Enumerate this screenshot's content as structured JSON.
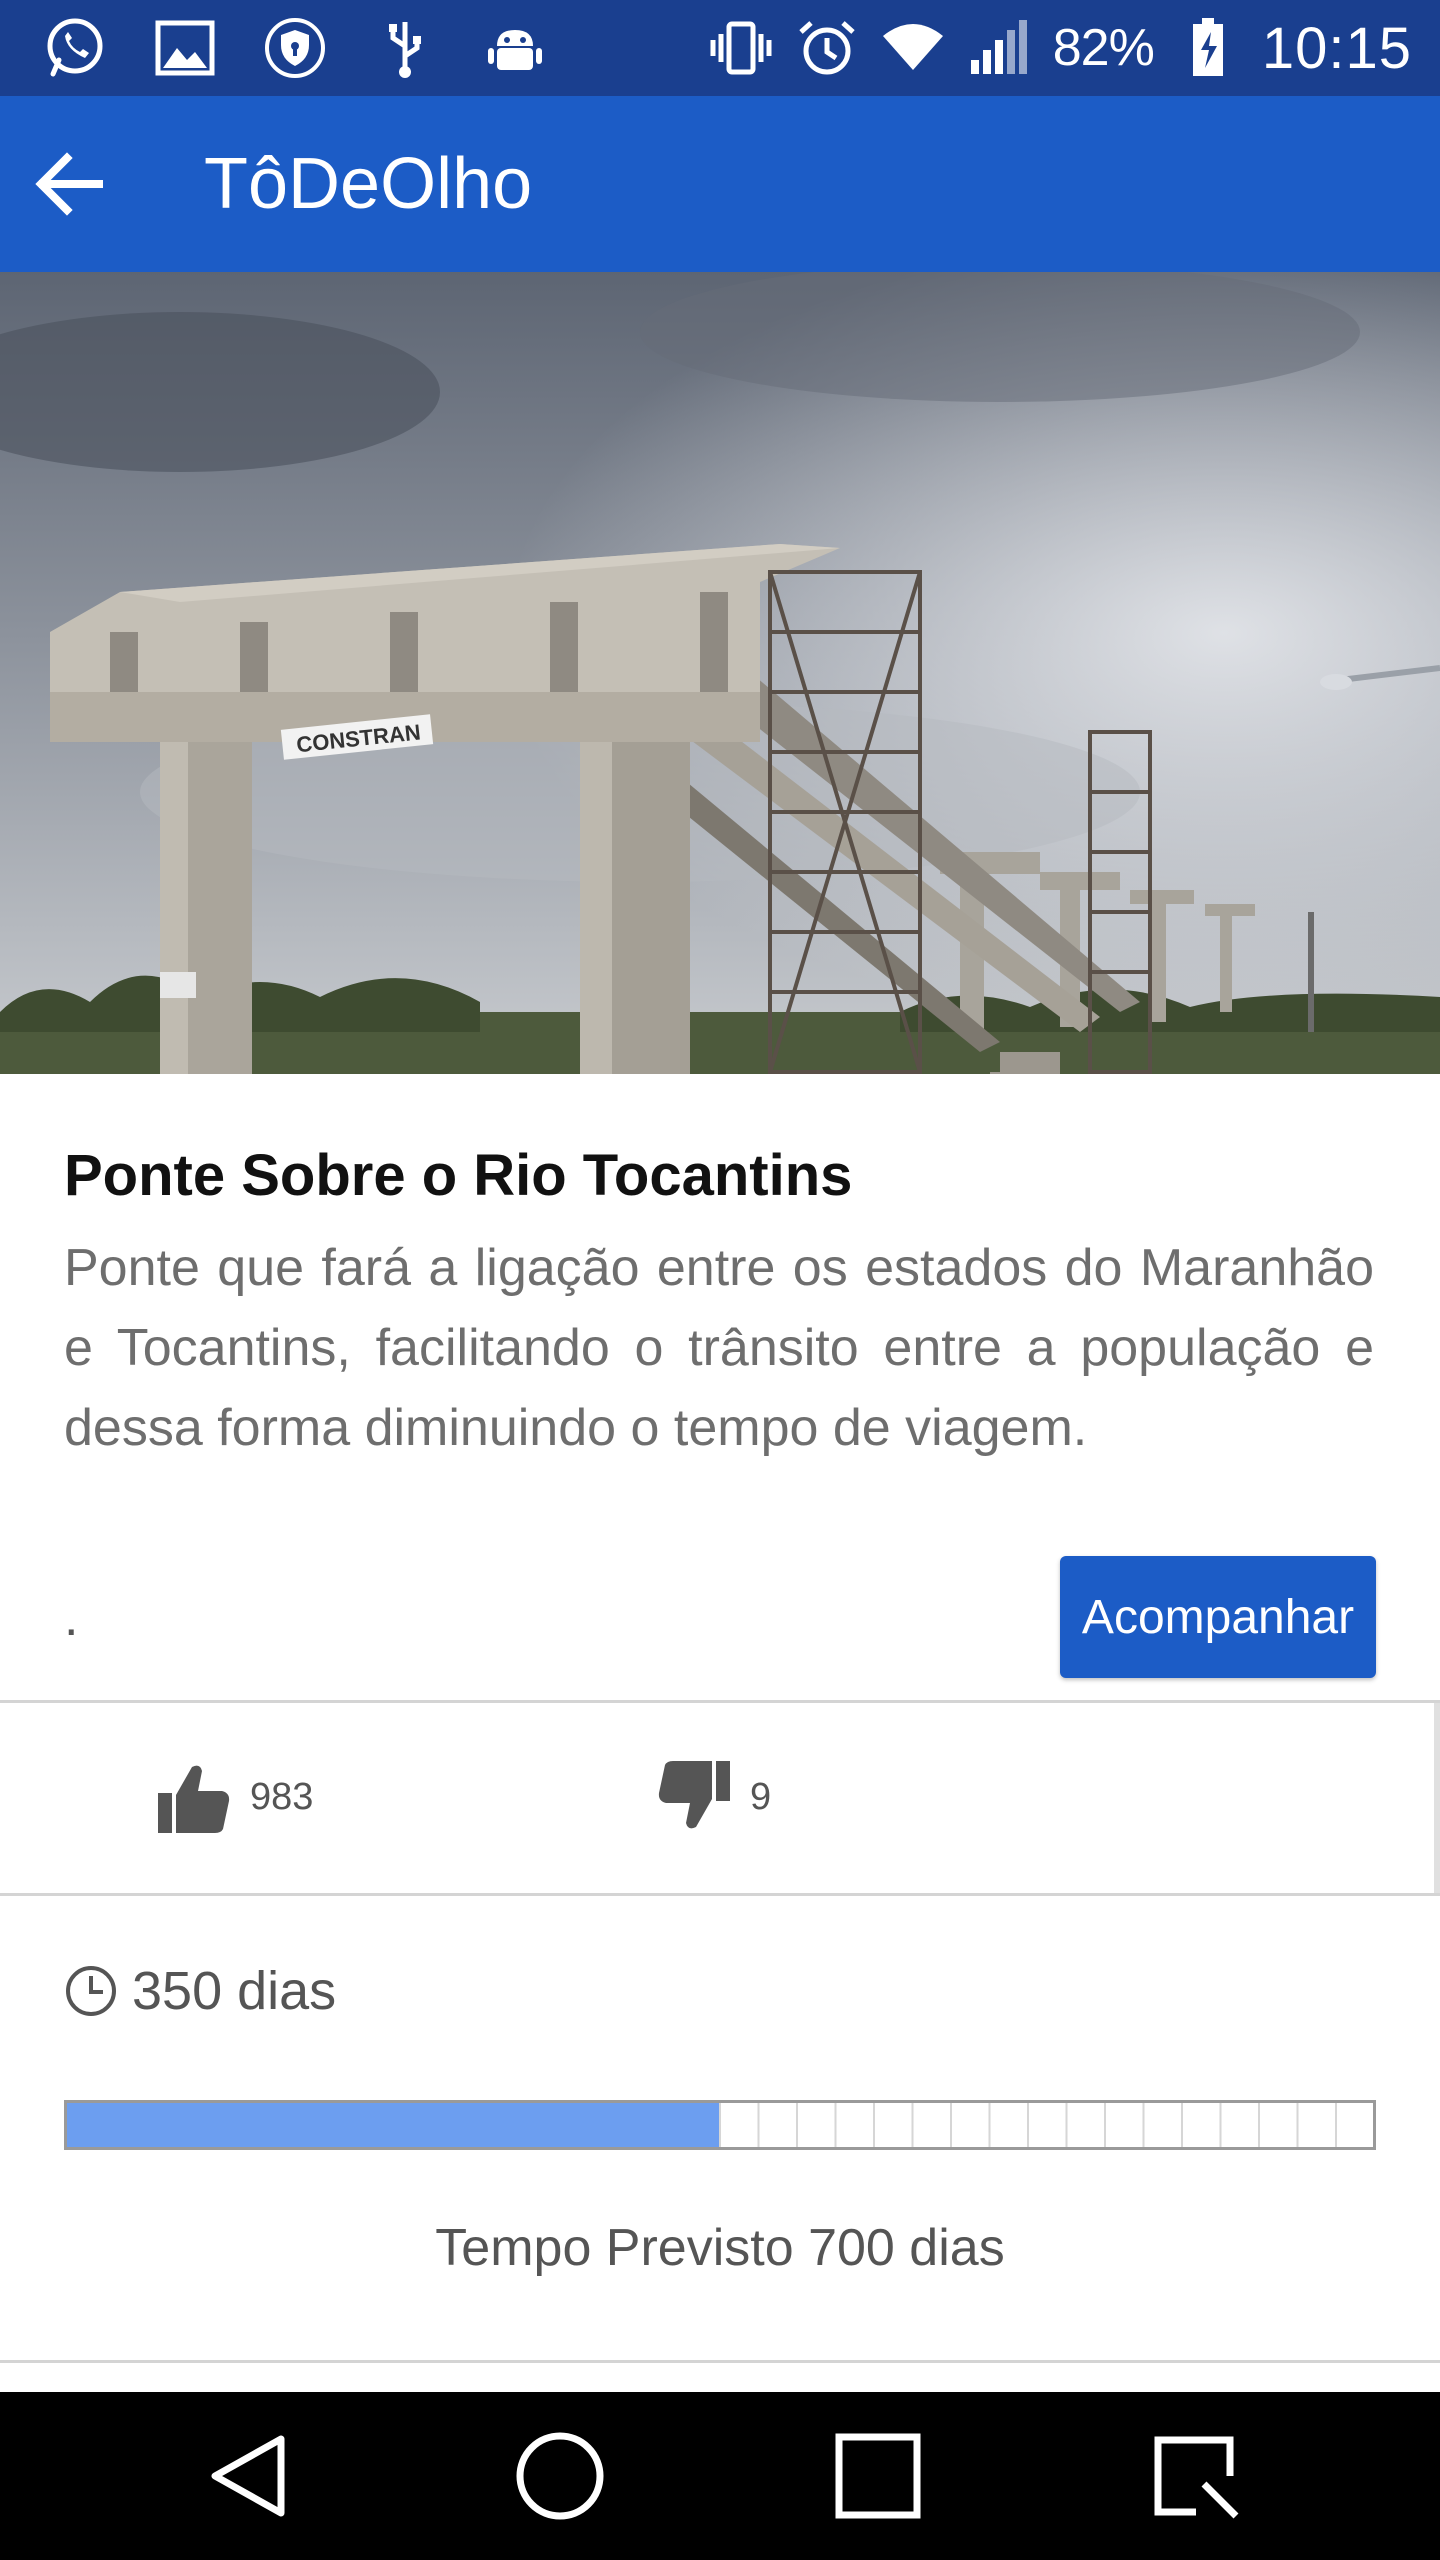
{
  "status_bar": {
    "battery_percent": "82%",
    "time": "10:15",
    "left_icons": [
      "whatsapp-icon",
      "gallery-icon",
      "shield-icon",
      "usb-icon",
      "android-icon"
    ],
    "right_icons": [
      "vibrate-icon",
      "alarm-icon",
      "wifi-icon",
      "signal-icon",
      "battery-charging-icon"
    ]
  },
  "app_bar": {
    "title": "TôDeOlho",
    "back_icon": "arrow-back-icon"
  },
  "hero": {
    "sign_text": "CONSTRAN"
  },
  "project": {
    "title": "Ponte Sobre o Rio Tocantins",
    "description": "Ponte que fará a ligação entre os estados do Maranhão e Tocantins, facilitando o trânsito entre a população e dessa forma diminuindo o tempo de viagem.",
    "extra": ".",
    "follow_label": "Acompanhar"
  },
  "votes": {
    "likes": "983",
    "dislikes": "9"
  },
  "progress": {
    "elapsed_text": "350 dias",
    "planned_text": "Tempo Previsto 700 dias",
    "elapsed_days": 350,
    "planned_days": 700
  },
  "colors": {
    "status_bar": "#1a3f8f",
    "app_bar": "#1c5cc6",
    "accent_button": "#1c5cc6",
    "progress_fill": "#6c9ef0"
  },
  "nav_bar": {
    "icons": [
      "nav-back-icon",
      "nav-home-icon",
      "nav-recents-icon",
      "nav-screenshot-icon"
    ]
  }
}
